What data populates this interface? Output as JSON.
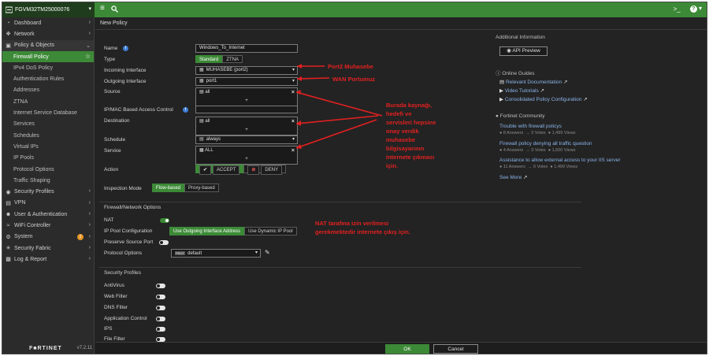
{
  "device_name": "FGVM32TM25000076",
  "top_bar": {
    "terminal_label": ">_",
    "help_label": "?"
  },
  "sidebar": {
    "items": [
      {
        "label": "Dashboard",
        "icon": "dashboard-icon"
      },
      {
        "label": "Network",
        "icon": "network-icon"
      },
      {
        "label": "Policy & Objects",
        "icon": "policy-icon"
      },
      {
        "label": "Firewall Policy"
      },
      {
        "label": "IPv4 DoS Policy"
      },
      {
        "label": "Authentication Rules"
      },
      {
        "label": "Addresses"
      },
      {
        "label": "ZTNA"
      },
      {
        "label": "Internet Service Database"
      },
      {
        "label": "Services"
      },
      {
        "label": "Schedules"
      },
      {
        "label": "Virtual IPs"
      },
      {
        "label": "IP Pools"
      },
      {
        "label": "Protocol Options"
      },
      {
        "label": "Traffic Shaping"
      },
      {
        "label": "Security Profiles",
        "icon": "lock-icon"
      },
      {
        "label": "VPN",
        "icon": "monitor-icon"
      },
      {
        "label": "User & Authentication",
        "icon": "user-icon"
      },
      {
        "label": "WiFi Controller",
        "icon": "wifi-icon"
      },
      {
        "label": "System",
        "icon": "gear-icon",
        "badge": "2"
      },
      {
        "label": "Security Fabric",
        "icon": "fabric-icon"
      },
      {
        "label": "Log & Report",
        "icon": "chart-icon"
      }
    ],
    "logo": "F■RTINET",
    "version": "v7.2.11"
  },
  "page_title": "New Policy",
  "form": {
    "name_label": "Name",
    "name_value": "Windows_To_Internet",
    "type_label": "Type",
    "type_options": [
      "Standard",
      "ZTNA"
    ],
    "incoming_label": "Incoming Interface",
    "incoming_value": "MUHASEBE (port2)",
    "outgoing_label": "Outgoing Interface",
    "outgoing_value": "port1",
    "source_label": "Source",
    "source_value": "all",
    "ipmac_label": "IP/MAC Based Access Control",
    "destination_label": "Destination",
    "destination_value": "all",
    "schedule_label": "Schedule",
    "schedule_value": "always",
    "service_label": "Service",
    "service_value": "ALL",
    "action_label": "Action",
    "action_accept": "ACCEPT",
    "action_deny": "DENY",
    "inspection_label": "Inspection Mode",
    "inspection_options": [
      "Flow-based",
      "Proxy-based"
    ],
    "plus": "+"
  },
  "firewall_section": {
    "title": "Firewall/Network Options",
    "nat_label": "NAT",
    "nat_enabled": true,
    "ippool_label": "IP Pool Configuration",
    "ippool_options": [
      "Use Outgoing Interface Address",
      "Use Dynamic IP Pool"
    ],
    "preserve_label": "Preserve Source Port",
    "preserve_enabled": false,
    "protocol_label": "Protocol Options",
    "protocol_prefix": "PROT",
    "protocol_value": "default"
  },
  "security_section": {
    "title": "Security Profiles",
    "items": [
      {
        "label": "AntiVirus",
        "enabled": false
      },
      {
        "label": "Web Filter",
        "enabled": false
      },
      {
        "label": "DNS Filter",
        "enabled": false
      },
      {
        "label": "Application Control",
        "enabled": false
      },
      {
        "label": "IPS",
        "enabled": false
      },
      {
        "label": "File Filter",
        "enabled": false
      }
    ]
  },
  "right_panel": {
    "additional_info": "Additional Information",
    "api_preview": "API Preview",
    "online_guides": "Online Guides",
    "guides": [
      "Relevant Documentation",
      "Video Tutorials",
      "Consolidated Policy Configuration"
    ],
    "community": "Fortinet Community",
    "posts": [
      {
        "title": "Trouble with firewall policys",
        "answers": "8 Answers",
        "votes": "0 Votes",
        "views": "1,499 Views"
      },
      {
        "title": "Firewall policy denying all traffic question",
        "answers": "4 Answers",
        "votes": "0 Votes",
        "views": "1,600 Views"
      },
      {
        "title": "Assistance to allow external access to your IIS server",
        "answers": "11 Answers",
        "votes": "0 Votes",
        "views": "1,499 Views"
      }
    ],
    "see_more": "See More"
  },
  "buttons": {
    "ok": "OK",
    "cancel": "Cancel"
  },
  "annotations": {
    "port2": "Port2 Muhasebe",
    "wan": "WAN Portumuz",
    "source_note": [
      "Burada kaynağı,",
      "hedefi ve",
      "servisleri hepsine",
      "onay verdik",
      "muhasebe",
      "bilgisayarının",
      "internete çıkması",
      "için."
    ],
    "nat_note": [
      "NAT tarafına izin verilmesi",
      "gerekmektedir internete çıkış için."
    ]
  },
  "colors": {
    "accent": "#3c8a37",
    "background": "#232323",
    "annotation": "#e32020",
    "link": "#8ab4ea"
  }
}
